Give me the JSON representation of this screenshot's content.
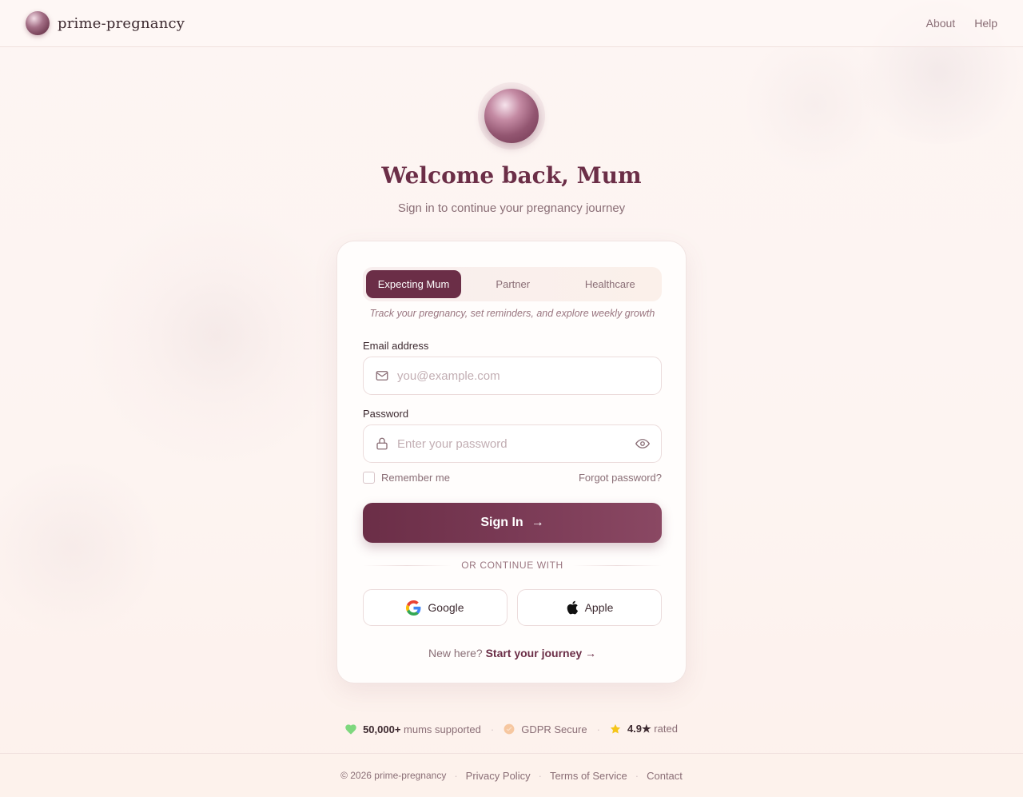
{
  "brand": {
    "name": "prime-pregnancy"
  },
  "nav": {
    "about": "About",
    "help": "Help"
  },
  "hero": {
    "title": "Welcome back, Mum",
    "subtitle": "Sign in to continue your pregnancy journey"
  },
  "tabs": [
    {
      "label": "Expecting Mum",
      "active": true
    },
    {
      "label": "Partner",
      "active": false
    },
    {
      "label": "Healthcare",
      "active": false
    }
  ],
  "tab_description": "Track your pregnancy, set reminders, and explore weekly growth",
  "form": {
    "email_label": "Email address",
    "email_placeholder": "you@example.com",
    "email_value": "",
    "password_label": "Password",
    "password_placeholder": "Enter your password",
    "password_value": "",
    "remember_label": "Remember me",
    "remember_checked": false,
    "forgot_label": "Forgot password?",
    "signin_label": "Sign In",
    "signin_arrow": "→",
    "divider_label": "OR CONTINUE WITH",
    "google_label": "Google",
    "apple_label": "Apple",
    "signup_prefix": "New here?",
    "signup_link": "Start your journey →"
  },
  "stats": {
    "mums_value": "50,000+",
    "mums_label": "mums supported",
    "gdpr_label": "GDPR Secure",
    "rating_value": "4.9★",
    "rating_label": "rated",
    "separator": "·"
  },
  "footer": {
    "copyright": "© 2026 prime-pregnancy",
    "privacy": "Privacy Policy",
    "terms": "Terms of Service",
    "contact": "Contact",
    "separator": "·"
  },
  "colors": {
    "primary": "#6b2e47",
    "muted": "#8a6e76",
    "heart": "#7ed87e",
    "star": "#f5c518",
    "shield": "#f6c7a0"
  },
  "icons": [
    "mail-icon",
    "lock-icon",
    "eye-icon",
    "google-icon",
    "apple-icon",
    "heart-icon",
    "shield-icon",
    "star-icon"
  ]
}
